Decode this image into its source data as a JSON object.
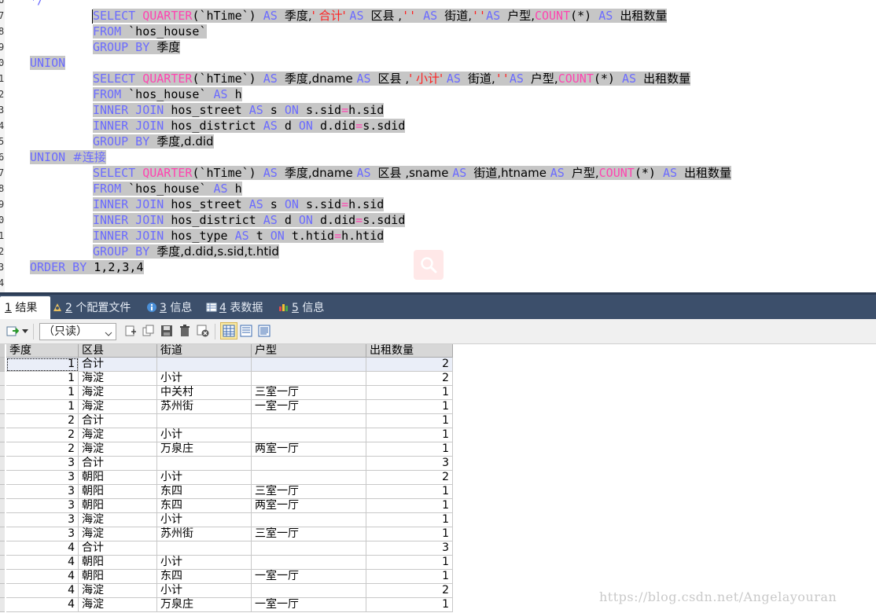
{
  "editor": {
    "line_numbers": [
      "6",
      "7",
      "8",
      "9",
      "0",
      "1",
      "2",
      "3",
      "4",
      "5",
      "6",
      "7",
      "8",
      "9",
      "0",
      "1",
      "2",
      "3",
      "4"
    ],
    "comment_tail": "*/",
    "lines": [
      {
        "indent": 1,
        "tokens": [
          [
            "kw",
            "SELECT "
          ],
          [
            "fn",
            "QUARTER"
          ],
          [
            "id",
            "(`hTime`) "
          ],
          [
            "kw",
            "AS "
          ],
          [
            "id",
            "季度,"
          ],
          [
            "str",
            "' 合计' "
          ],
          [
            "kw",
            "AS "
          ],
          [
            "id",
            "区县 ,"
          ],
          [
            "str",
            "'' "
          ],
          [
            "kw",
            "AS "
          ],
          [
            "id",
            "街道,"
          ],
          [
            "str",
            "''"
          ],
          [
            "kw",
            "AS "
          ],
          [
            "id",
            "户型,"
          ],
          [
            "fn",
            "COUNT"
          ],
          [
            "id",
            "(*) "
          ],
          [
            "kw",
            "AS "
          ],
          [
            "id",
            "出租数量"
          ]
        ]
      },
      {
        "indent": 1,
        "tokens": [
          [
            "kw",
            "FROM "
          ],
          [
            "id",
            "`hos_house`"
          ]
        ]
      },
      {
        "indent": 1,
        "tokens": [
          [
            "kw",
            "GROUP BY "
          ],
          [
            "id",
            "季度"
          ]
        ]
      },
      {
        "indent": 0,
        "tokens": [
          [
            "kw",
            "UNION"
          ]
        ]
      },
      {
        "indent": 1,
        "tokens": [
          [
            "kw",
            "SELECT "
          ],
          [
            "fn",
            "QUARTER"
          ],
          [
            "id",
            "(`hTime`) "
          ],
          [
            "kw",
            "AS "
          ],
          [
            "id",
            "季度,dname "
          ],
          [
            "kw",
            "AS "
          ],
          [
            "id",
            "区县 ,"
          ],
          [
            "str",
            "' 小计' "
          ],
          [
            "kw",
            "AS "
          ],
          [
            "id",
            "街道,"
          ],
          [
            "str",
            "''"
          ],
          [
            "kw",
            "AS "
          ],
          [
            "id",
            "户型,"
          ],
          [
            "fn",
            "COUNT"
          ],
          [
            "id",
            "(*) "
          ],
          [
            "kw",
            "AS "
          ],
          [
            "id",
            "出租数量"
          ]
        ]
      },
      {
        "indent": 1,
        "tokens": [
          [
            "kw",
            "FROM "
          ],
          [
            "id",
            "`hos_house` "
          ],
          [
            "kw",
            "AS "
          ],
          [
            "id",
            "h"
          ]
        ]
      },
      {
        "indent": 1,
        "tokens": [
          [
            "kw",
            "INNER JOIN "
          ],
          [
            "id",
            "hos_street "
          ],
          [
            "kw",
            "AS "
          ],
          [
            "id",
            "s "
          ],
          [
            "kw",
            "ON "
          ],
          [
            "id",
            "s.sid"
          ],
          [
            "fn",
            "="
          ],
          [
            "id",
            "h.sid"
          ]
        ]
      },
      {
        "indent": 1,
        "tokens": [
          [
            "kw",
            "INNER JOIN "
          ],
          [
            "id",
            "hos_district "
          ],
          [
            "kw",
            "AS "
          ],
          [
            "id",
            "d "
          ],
          [
            "kw",
            "ON "
          ],
          [
            "id",
            "d.did"
          ],
          [
            "fn",
            "="
          ],
          [
            "id",
            "s.sdid"
          ]
        ]
      },
      {
        "indent": 1,
        "tokens": [
          [
            "kw",
            "GROUP BY "
          ],
          [
            "id",
            "季度,d.did"
          ]
        ]
      },
      {
        "indent": 0,
        "tokens": [
          [
            "kw",
            "UNION "
          ],
          [
            "cm",
            "#连接"
          ]
        ]
      },
      {
        "indent": 1,
        "tokens": [
          [
            "kw",
            "SELECT "
          ],
          [
            "fn",
            "QUARTER"
          ],
          [
            "id",
            "(`hTime`) "
          ],
          [
            "kw",
            "AS "
          ],
          [
            "id",
            "季度,dname "
          ],
          [
            "kw",
            "AS "
          ],
          [
            "id",
            "区县 ,sname "
          ],
          [
            "kw",
            "AS "
          ],
          [
            "id",
            "街道,htname "
          ],
          [
            "kw",
            "AS "
          ],
          [
            "id",
            "户型,"
          ],
          [
            "fn",
            "COUNT"
          ],
          [
            "id",
            "(*) "
          ],
          [
            "kw",
            "AS "
          ],
          [
            "id",
            "出租数量"
          ]
        ]
      },
      {
        "indent": 1,
        "tokens": [
          [
            "kw",
            "FROM "
          ],
          [
            "id",
            "`hos_house` "
          ],
          [
            "kw",
            "AS "
          ],
          [
            "id",
            "h"
          ]
        ]
      },
      {
        "indent": 1,
        "tokens": [
          [
            "kw",
            "INNER JOIN "
          ],
          [
            "id",
            "hos_street "
          ],
          [
            "kw",
            "AS "
          ],
          [
            "id",
            "s "
          ],
          [
            "kw",
            "ON "
          ],
          [
            "id",
            "s.sid"
          ],
          [
            "fn",
            "="
          ],
          [
            "id",
            "h.sid"
          ]
        ]
      },
      {
        "indent": 1,
        "tokens": [
          [
            "kw",
            "INNER JOIN "
          ],
          [
            "id",
            "hos_district "
          ],
          [
            "kw",
            "AS "
          ],
          [
            "id",
            "d "
          ],
          [
            "kw",
            "ON "
          ],
          [
            "id",
            "d.did"
          ],
          [
            "fn",
            "="
          ],
          [
            "id",
            "s.sdid"
          ]
        ]
      },
      {
        "indent": 1,
        "tokens": [
          [
            "kw",
            "INNER JOIN "
          ],
          [
            "id",
            "hos_type "
          ],
          [
            "kw",
            "AS "
          ],
          [
            "id",
            "t "
          ],
          [
            "kw",
            "ON "
          ],
          [
            "id",
            "t.htid"
          ],
          [
            "fn",
            "="
          ],
          [
            "id",
            "h.htid"
          ]
        ]
      },
      {
        "indent": 1,
        "tokens": [
          [
            "kw",
            "GROUP BY "
          ],
          [
            "id",
            "季度,d.did,s.sid,t.htid"
          ]
        ]
      },
      {
        "indent": 0,
        "tokens": [
          [
            "kw",
            "ORDER BY "
          ],
          [
            "id",
            "1,2,3,4"
          ]
        ]
      }
    ]
  },
  "tabs": [
    {
      "num": "1",
      "label": " 结果",
      "icon": "results-icon",
      "active": true
    },
    {
      "num": "2",
      "label": " 个配置文件",
      "icon": "profile-icon",
      "active": false
    },
    {
      "num": "3",
      "label": " 信息",
      "icon": "info-icon",
      "active": false
    },
    {
      "num": "4",
      "label": " 表数据",
      "icon": "table-data-icon",
      "active": false
    },
    {
      "num": "5",
      "label": " 信息",
      "icon": "messages-icon",
      "active": false
    }
  ],
  "toolbar": {
    "mode_label": "（只读）",
    "icons": [
      "export-icon",
      "dropdown-arrow-icon",
      "insert-row-icon",
      "copy-row-icon",
      "save-icon",
      "delete-icon",
      "cancel-icon",
      "grid-view-icon",
      "form-view-icon",
      "text-view-icon"
    ]
  },
  "grid": {
    "columns": [
      "季度",
      "区县",
      "街道",
      "户型",
      "出租数量"
    ],
    "rows": [
      [
        "1",
        " 合计",
        "",
        "",
        "2"
      ],
      [
        "1",
        "海淀",
        " 小计",
        "",
        "2"
      ],
      [
        "1",
        "海淀",
        "中关村",
        "三室一厅",
        "1"
      ],
      [
        "1",
        "海淀",
        "苏州街",
        "一室一厅",
        "1"
      ],
      [
        "2",
        " 合计",
        "",
        "",
        "1"
      ],
      [
        "2",
        "海淀",
        " 小计",
        "",
        "1"
      ],
      [
        "2",
        "海淀",
        "万泉庄",
        "两室一厅",
        "1"
      ],
      [
        "3",
        " 合计",
        "",
        "",
        "3"
      ],
      [
        "3",
        "朝阳",
        " 小计",
        "",
        "2"
      ],
      [
        "3",
        "朝阳",
        "东四",
        "三室一厅",
        "1"
      ],
      [
        "3",
        "朝阳",
        "东四",
        "两室一厅",
        "1"
      ],
      [
        "3",
        "海淀",
        " 小计",
        "",
        "1"
      ],
      [
        "3",
        "海淀",
        "苏州街",
        "三室一厅",
        "1"
      ],
      [
        "4",
        " 合计",
        "",
        "",
        "3"
      ],
      [
        "4",
        "朝阳",
        " 小计",
        "",
        "1"
      ],
      [
        "4",
        "朝阳",
        "东四",
        "一室一厅",
        "1"
      ],
      [
        "4",
        "海淀",
        " 小计",
        "",
        "2"
      ],
      [
        "4",
        "海淀",
        "万泉庄",
        "一室一厅",
        "1"
      ]
    ]
  },
  "watermark": "https://blog.csdn.net/Angelayouran"
}
